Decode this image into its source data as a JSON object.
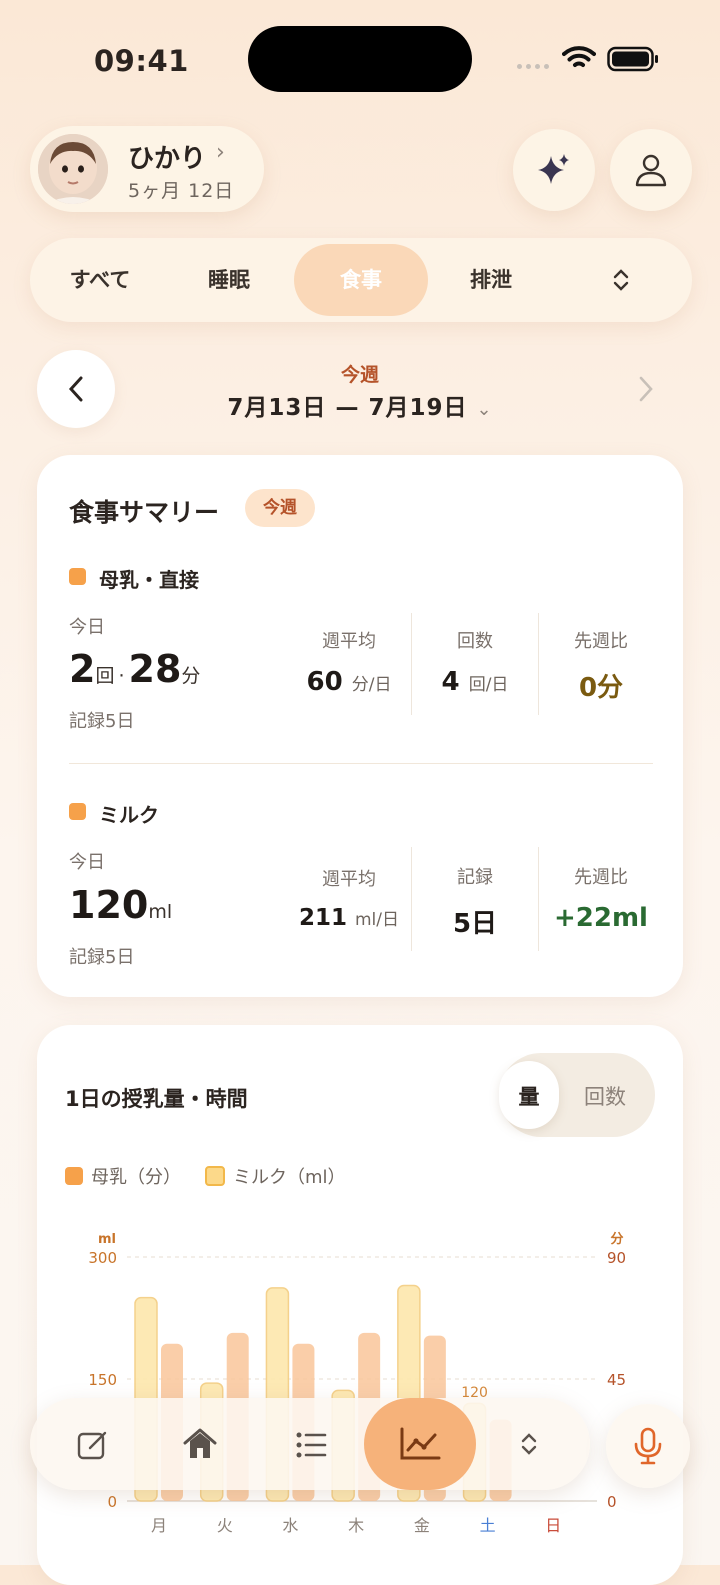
{
  "status_bar": {
    "time": "09:41"
  },
  "profile": {
    "name": "ひかり",
    "age": "5ヶ月 12日"
  },
  "tabs": [
    {
      "label": "すべて",
      "active": false
    },
    {
      "label": "睡眠",
      "active": false
    },
    {
      "label": "食事",
      "active": true
    },
    {
      "label": "排泄",
      "active": false
    }
  ],
  "week_nav": {
    "label": "今週",
    "range": "7月13日 — 7月19日"
  },
  "summary": {
    "title": "食事サマリー",
    "badge": "今週",
    "breast": {
      "name": "母乳・直接",
      "today_label": "今日",
      "today_count": "2",
      "count_unit": "回",
      "sep": "·",
      "today_minutes": "28",
      "minutes_unit": "分",
      "record": "記録5日",
      "avg_label": "週平均",
      "avg_value": "60",
      "avg_unit": "分/日",
      "count_label": "回数",
      "count_value": "4",
      "count_value_unit": "回/日",
      "diff_label": "先週比",
      "diff_value": "0分",
      "diff_color": "#7a5a10"
    },
    "milk": {
      "name": "ミルク",
      "today_label": "今日",
      "today_value": "120",
      "today_unit": "ml",
      "record": "記録5日",
      "avg_label": "週平均",
      "avg_value": "211",
      "avg_unit": "ml/日",
      "rec_label": "記録",
      "rec_value": "5日",
      "diff_label": "先週比",
      "diff_value": "+22ml",
      "diff_color": "#2a6a32"
    }
  },
  "chart_card": {
    "title": "1日の授乳量・時間",
    "toggle": [
      {
        "label": "量",
        "active": true
      },
      {
        "label": "回数",
        "active": false
      }
    ],
    "legend": [
      {
        "label": "母乳（分）",
        "color": "#f6a14a"
      },
      {
        "label": "ミルク（ml）",
        "color": "#fcd98a"
      }
    ]
  },
  "chart_data": {
    "type": "bar",
    "categories": [
      "月",
      "火",
      "水",
      "木",
      "金",
      "土",
      "日"
    ],
    "category_colors": [
      "#8c827a",
      "#8c827a",
      "#8c827a",
      "#8c827a",
      "#8c827a",
      "#4a7fd4",
      "#c94c3a"
    ],
    "left_axis": {
      "unit": "ml",
      "ticks": [
        "300",
        "150",
        "0"
      ],
      "range": [
        0,
        300
      ]
    },
    "right_axis": {
      "unit": "分",
      "ticks": [
        "90",
        "45",
        "0"
      ],
      "range": [
        0,
        90
      ]
    },
    "series": [
      {
        "name": "ミルク（ml）",
        "axis": "left",
        "values": [
          250,
          145,
          262,
          136,
          265,
          120,
          null
        ],
        "color": "#fcd98a"
      },
      {
        "name": "母乳（分）",
        "axis": "right",
        "values": [
          58,
          62,
          58,
          62,
          61,
          30,
          null
        ],
        "color": "#f6a14a"
      }
    ],
    "annotations": [
      {
        "category": "土",
        "label": "120"
      }
    ],
    "grid": true
  },
  "tabbar": {
    "items": [
      "edit-icon",
      "home-icon",
      "list-icon",
      "chart-icon",
      "expand-icon"
    ],
    "active": "chart-icon"
  },
  "mic": {
    "icon": "mic-icon"
  }
}
